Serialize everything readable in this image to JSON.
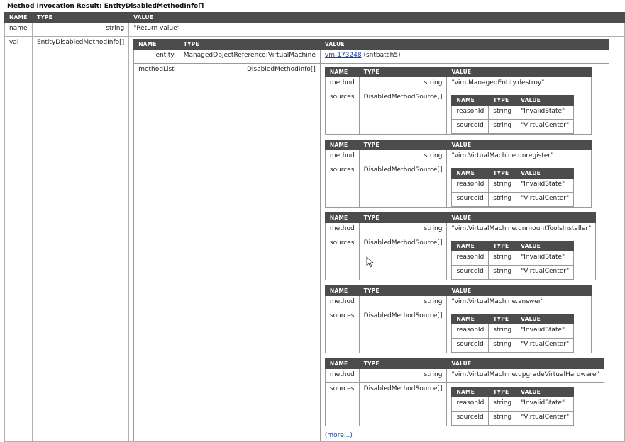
{
  "title": "Method Invocation Result: EntityDisabledMethodInfo[]",
  "headers": {
    "name": "NAME",
    "type": "TYPE",
    "value": "VALUE"
  },
  "outer": {
    "name_row": {
      "name": "name",
      "type": "string",
      "value": "\"Return value\""
    },
    "val_row": {
      "name": "val",
      "type": "EntityDisabledMethodInfo[]"
    }
  },
  "entity_info": {
    "entity": {
      "name": "entity",
      "type": "ManagedObjectReference:VirtualMachine",
      "link": "vm-173248",
      "suffix": " (sntbatch5)"
    },
    "methodList": {
      "name": "methodList",
      "type": "DisabledMethodInfo[]"
    }
  },
  "methods": [
    {
      "method_label": "method",
      "method_type": "string",
      "method_value": "\"vim.ManagedEntity.destroy\"",
      "sources_label": "sources",
      "sources_type": "DisabledMethodSource[]",
      "reason_label": "reasonId",
      "reason_type": "string",
      "reason_value": "\"InvalidState\"",
      "source_label": "sourceId",
      "source_type": "string",
      "source_value": "\"VirtualCenter\""
    },
    {
      "method_label": "method",
      "method_type": "string",
      "method_value": "\"vim.VirtualMachine.unregister\"",
      "sources_label": "sources",
      "sources_type": "DisabledMethodSource[]",
      "reason_label": "reasonId",
      "reason_type": "string",
      "reason_value": "\"InvalidState\"",
      "source_label": "sourceId",
      "source_type": "string",
      "source_value": "\"VirtualCenter\""
    },
    {
      "method_label": "method",
      "method_type": "string",
      "method_value": "\"vim.VirtualMachine.unmountToolsInstaller\"",
      "sources_label": "sources",
      "sources_type": "DisabledMethodSource[]",
      "reason_label": "reasonId",
      "reason_type": "string",
      "reason_value": "\"InvalidState\"",
      "source_label": "sourceId",
      "source_type": "string",
      "source_value": "\"VirtualCenter\""
    },
    {
      "method_label": "method",
      "method_type": "string",
      "method_value": "\"vim.VirtualMachine.answer\"",
      "sources_label": "sources",
      "sources_type": "DisabledMethodSource[]",
      "reason_label": "reasonId",
      "reason_type": "string",
      "reason_value": "\"InvalidState\"",
      "source_label": "sourceId",
      "source_type": "string",
      "source_value": "\"VirtualCenter\""
    },
    {
      "method_label": "method",
      "method_type": "string",
      "method_value": "\"vim.VirtualMachine.upgradeVirtualHardware\"",
      "sources_label": "sources",
      "sources_type": "DisabledMethodSource[]",
      "reason_label": "reasonId",
      "reason_type": "string",
      "reason_value": "\"InvalidState\"",
      "source_label": "sourceId",
      "source_type": "string",
      "source_value": "\"VirtualCenter\""
    }
  ],
  "more_link": "(more...)",
  "cursor_icon": "mouse-pointer-icon"
}
